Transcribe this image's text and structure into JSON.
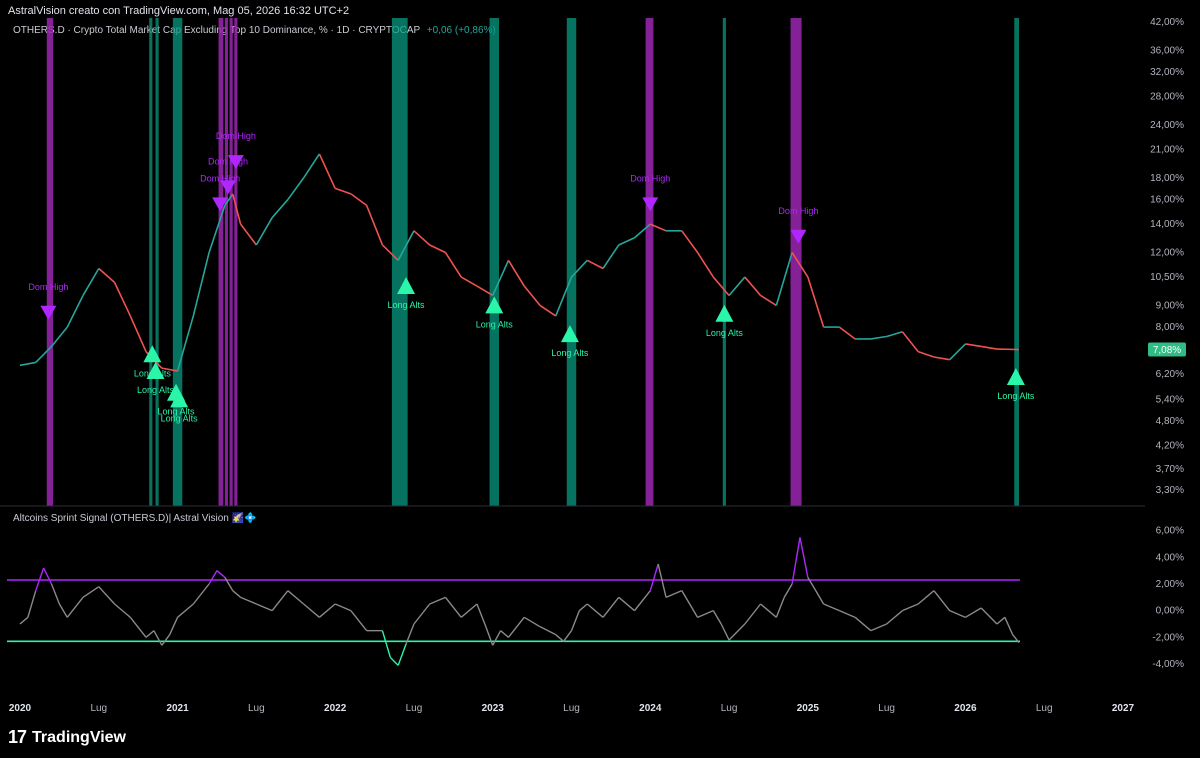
{
  "header": {
    "credit": "AstralVision creato con TradingView.com, Mag 05, 2026 16:32 UTC+2",
    "symbol": "OTHERS.D · Crypto Total Market Cap Excluding Top 10 Dominance, % · 1D · CRYPTOCAP",
    "change": "+0,06 (+0,86%)"
  },
  "indicator": {
    "title": "Altcoins Sprint Signal (OTHERS.D)| Astral Vision",
    "emoji": "🌠💠"
  },
  "brand": {
    "mark": "17",
    "name": "TradingView"
  },
  "colors": {
    "purple": "#9c27b0",
    "green": "#089981",
    "teal": "#2af5a9",
    "oscLine": "#8a8a8a",
    "priceLabel": "#2ebd85"
  },
  "chart_data": [
    {
      "type": "line",
      "series_name": "OTHERS.D",
      "scale": "log",
      "x_ticks": [
        "2020",
        "Lug",
        "2021",
        "Lug",
        "2022",
        "Lug",
        "2023",
        "Lug",
        "2024",
        "Lug",
        "2025",
        "Lug",
        "2026",
        "Lug",
        "2027"
      ],
      "y_ticks": [
        "42,00%",
        "36,00%",
        "32,00%",
        "28,00%",
        "24,00%",
        "21,00%",
        "18,00%",
        "16,00%",
        "14,00%",
        "12,00%",
        "10,50%",
        "9,00%",
        "8,00%",
        "7,00%",
        "6,20%",
        "5,40%",
        "4,80%",
        "4,20%",
        "3,70%",
        "3,30%"
      ],
      "current_value_label": "7,08%",
      "x": [
        2020.0,
        2020.1,
        2020.2,
        2020.3,
        2020.4,
        2020.5,
        2020.6,
        2020.7,
        2020.8,
        2020.9,
        2021.0,
        2021.1,
        2021.2,
        2021.3,
        2021.35,
        2021.4,
        2021.5,
        2021.6,
        2021.7,
        2021.8,
        2021.9,
        2022.0,
        2022.1,
        2022.2,
        2022.3,
        2022.4,
        2022.5,
        2022.6,
        2022.7,
        2022.8,
        2022.9,
        2023.0,
        2023.1,
        2023.2,
        2023.3,
        2023.4,
        2023.5,
        2023.6,
        2023.7,
        2023.8,
        2023.9,
        2024.0,
        2024.1,
        2024.2,
        2024.3,
        2024.4,
        2024.5,
        2024.6,
        2024.7,
        2024.8,
        2024.9,
        2025.0,
        2025.1,
        2025.2,
        2025.3,
        2025.4,
        2025.5,
        2025.6,
        2025.7,
        2025.8,
        2025.9,
        2026.0,
        2026.1,
        2026.2,
        2026.34
      ],
      "y": [
        6.5,
        6.6,
        7.2,
        8.0,
        9.5,
        11.0,
        10.2,
        8.5,
        7.0,
        6.4,
        6.3,
        8.5,
        12.0,
        15.5,
        16.5,
        14.0,
        12.5,
        14.5,
        16.0,
        18.0,
        20.5,
        17.0,
        16.5,
        15.5,
        12.5,
        11.5,
        13.5,
        12.5,
        12.0,
        10.5,
        10.0,
        9.5,
        11.5,
        10.0,
        9.0,
        8.5,
        10.5,
        11.5,
        11.0,
        12.5,
        13.0,
        14.0,
        13.5,
        13.5,
        12.0,
        10.5,
        9.5,
        10.5,
        9.5,
        9.0,
        12.0,
        10.5,
        8.0,
        8.0,
        7.5,
        7.5,
        7.6,
        7.8,
        7.0,
        6.8,
        6.7,
        7.3,
        7.2,
        7.1,
        7.08
      ],
      "signals": [
        {
          "x": 2020.18,
          "y": 8.6,
          "kind": "top",
          "label": "Dom High"
        },
        {
          "x": 2020.84,
          "y": 6.9,
          "kind": "bottom",
          "label": "Long Alts"
        },
        {
          "x": 2020.86,
          "y": 6.3,
          "kind": "bottom",
          "label": "Long Alts"
        },
        {
          "x": 2020.99,
          "y": 5.6,
          "kind": "bottom",
          "label": "Long Alts"
        },
        {
          "x": 2021.01,
          "y": 5.4,
          "kind": "bottom",
          "label": "Long Alts"
        },
        {
          "x": 2021.27,
          "y": 15.5,
          "kind": "top",
          "label": "Dom High"
        },
        {
          "x": 2021.32,
          "y": 17.0,
          "kind": "top",
          "label": "Dom High"
        },
        {
          "x": 2021.37,
          "y": 19.5,
          "kind": "top",
          "label": "Dom High"
        },
        {
          "x": 2022.45,
          "y": 10.0,
          "kind": "bottom",
          "label": "Long Alts"
        },
        {
          "x": 2023.01,
          "y": 9.0,
          "kind": "bottom",
          "label": "Long Alts"
        },
        {
          "x": 2023.49,
          "y": 7.7,
          "kind": "bottom",
          "label": "Long Alts"
        },
        {
          "x": 2024.0,
          "y": 15.5,
          "kind": "top",
          "label": "Dom High"
        },
        {
          "x": 2024.47,
          "y": 8.6,
          "kind": "bottom",
          "label": "Long Alts"
        },
        {
          "x": 2024.94,
          "y": 13.0,
          "kind": "top",
          "label": "Dom High"
        },
        {
          "x": 2026.32,
          "y": 6.1,
          "kind": "bottom",
          "label": "Long Alts"
        }
      ],
      "bands": [
        {
          "from": 2020.17,
          "to": 2020.21,
          "color": "purple"
        },
        {
          "from": 2020.82,
          "to": 2020.84,
          "color": "green"
        },
        {
          "from": 2020.86,
          "to": 2020.88,
          "color": "green"
        },
        {
          "from": 2020.97,
          "to": 2021.03,
          "color": "green"
        },
        {
          "from": 2021.26,
          "to": 2021.29,
          "color": "purple"
        },
        {
          "from": 2021.3,
          "to": 2021.32,
          "color": "purple"
        },
        {
          "from": 2021.33,
          "to": 2021.35,
          "color": "purple"
        },
        {
          "from": 2021.36,
          "to": 2021.38,
          "color": "purple"
        },
        {
          "from": 2022.36,
          "to": 2022.46,
          "color": "green"
        },
        {
          "from": 2022.98,
          "to": 2023.04,
          "color": "green"
        },
        {
          "from": 2023.47,
          "to": 2023.53,
          "color": "green"
        },
        {
          "from": 2023.97,
          "to": 2024.02,
          "color": "purple"
        },
        {
          "from": 2024.46,
          "to": 2024.48,
          "color": "green"
        },
        {
          "from": 2024.89,
          "to": 2024.96,
          "color": "purple"
        },
        {
          "from": 2026.31,
          "to": 2026.34,
          "color": "green"
        }
      ]
    },
    {
      "type": "line",
      "series_name": "Altcoins Sprint Signal",
      "y_ticks": [
        "6,00%",
        "4,00%",
        "2,00%",
        "0,00%",
        "-2,00%",
        "-4,00%"
      ],
      "ylim": [
        -4.9,
        6.8
      ],
      "upper_level": 2.3,
      "lower_level": -2.3,
      "x": [
        2020.0,
        2020.05,
        2020.1,
        2020.15,
        2020.2,
        2020.25,
        2020.3,
        2020.4,
        2020.5,
        2020.6,
        2020.7,
        2020.8,
        2020.85,
        2020.9,
        2020.95,
        2021.0,
        2021.1,
        2021.2,
        2021.25,
        2021.3,
        2021.35,
        2021.4,
        2021.5,
        2021.6,
        2021.7,
        2021.8,
        2021.9,
        2022.0,
        2022.1,
        2022.2,
        2022.3,
        2022.35,
        2022.4,
        2022.45,
        2022.5,
        2022.6,
        2022.7,
        2022.8,
        2022.9,
        2022.95,
        2023.0,
        2023.05,
        2023.1,
        2023.2,
        2023.3,
        2023.4,
        2023.45,
        2023.5,
        2023.55,
        2023.6,
        2023.7,
        2023.8,
        2023.9,
        2024.0,
        2024.05,
        2024.1,
        2024.2,
        2024.3,
        2024.4,
        2024.45,
        2024.5,
        2024.6,
        2024.7,
        2024.8,
        2024.85,
        2024.9,
        2024.95,
        2025.0,
        2025.05,
        2025.1,
        2025.2,
        2025.3,
        2025.4,
        2025.5,
        2025.6,
        2025.7,
        2025.8,
        2025.9,
        2026.0,
        2026.1,
        2026.2,
        2026.25,
        2026.3,
        2026.34
      ],
      "y": [
        -1.0,
        -0.5,
        1.5,
        3.2,
        2.0,
        0.5,
        -0.5,
        1.0,
        1.8,
        0.5,
        -0.5,
        -2.0,
        -1.5,
        -2.6,
        -1.8,
        -0.5,
        0.5,
        2.0,
        3.0,
        2.5,
        1.5,
        1.0,
        0.5,
        0.0,
        1.5,
        0.5,
        -0.5,
        0.5,
        0.0,
        -1.5,
        -1.5,
        -3.5,
        -4.1,
        -2.5,
        -1.0,
        0.5,
        1.0,
        -0.5,
        0.5,
        -1.0,
        -2.6,
        -1.5,
        -2.0,
        -0.5,
        -1.2,
        -1.8,
        -2.3,
        -1.5,
        0.0,
        0.5,
        -0.5,
        1.0,
        0.0,
        1.5,
        3.5,
        1.0,
        1.5,
        -0.5,
        0.0,
        -1.0,
        -2.2,
        -1.0,
        0.5,
        -0.5,
        1.0,
        2.0,
        5.5,
        2.5,
        1.5,
        0.5,
        0.0,
        -0.5,
        -1.5,
        -1.0,
        0.0,
        0.5,
        1.5,
        0.0,
        -0.5,
        0.2,
        -1.0,
        -0.5,
        -1.8,
        -2.4
      ]
    }
  ]
}
